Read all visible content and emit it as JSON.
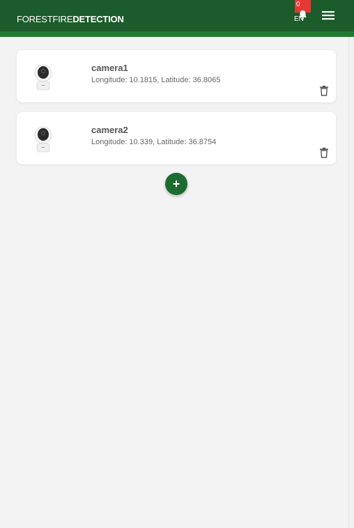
{
  "header": {
    "brand_light": "FORESTFIRE",
    "brand_bold": "DETECTION",
    "notification_count": "0",
    "notification_label": "EN",
    "menu_icon": "hamburger-menu-icon",
    "bell_icon": "bell-icon"
  },
  "cameras": [
    {
      "name": "camera1",
      "coords": "Longitude: 10.1815, Latitude: 36.8065",
      "delete_icon": "trash-icon"
    },
    {
      "name": "camera2",
      "coords": "Longitude: 10.339, Latitude: 36.8754",
      "delete_icon": "trash-icon"
    }
  ],
  "add_button": {
    "label": "+"
  },
  "colors": {
    "header": "#1c5b2a",
    "header_stripe": "#217a33",
    "badge": "#e53935",
    "add_button": "#1c6b31",
    "background": "#f3f3f3"
  }
}
